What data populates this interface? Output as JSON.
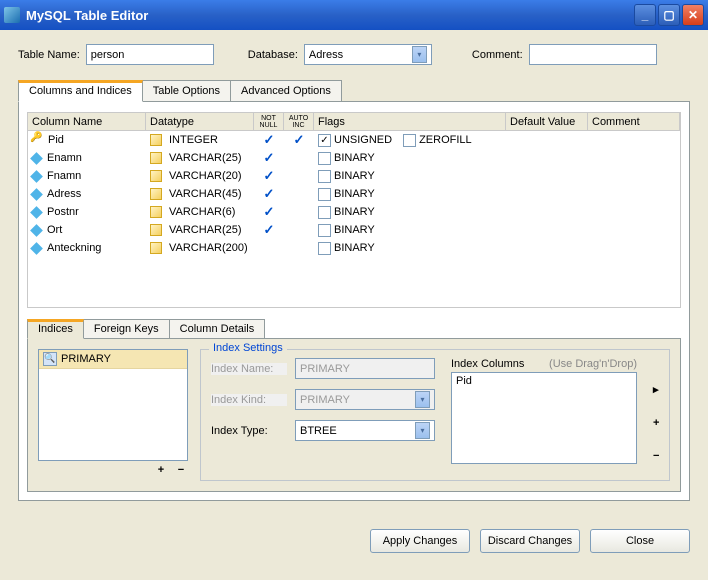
{
  "window": {
    "title": "MySQL Table Editor"
  },
  "top": {
    "table_name_label": "Table Name:",
    "table_name": "person",
    "database_label": "Database:",
    "database": "Adress",
    "comment_label": "Comment:",
    "comment": ""
  },
  "tabs": [
    "Columns and Indices",
    "Table Options",
    "Advanced Options"
  ],
  "col_headers": {
    "name": "Column Name",
    "datatype": "Datatype",
    "notnull": "NOT NULL",
    "autoinc": "AUTO INC",
    "flags": "Flags",
    "default": "Default Value",
    "comment": "Comment"
  },
  "columns": [
    {
      "icon": "key",
      "name": "Pid",
      "datatype": "INTEGER",
      "notnull": true,
      "autoinc": true,
      "flags": [
        {
          "label": "UNSIGNED",
          "checked": true
        },
        {
          "label": "ZEROFILL",
          "checked": false
        }
      ]
    },
    {
      "icon": "diamond",
      "name": "Enamn",
      "datatype": "VARCHAR(25)",
      "notnull": true,
      "autoinc": false,
      "flags": [
        {
          "label": "BINARY",
          "checked": false
        }
      ]
    },
    {
      "icon": "diamond",
      "name": "Fnamn",
      "datatype": "VARCHAR(20)",
      "notnull": true,
      "autoinc": false,
      "flags": [
        {
          "label": "BINARY",
          "checked": false
        }
      ]
    },
    {
      "icon": "diamond",
      "name": "Adress",
      "datatype": "VARCHAR(45)",
      "notnull": true,
      "autoinc": false,
      "flags": [
        {
          "label": "BINARY",
          "checked": false
        }
      ]
    },
    {
      "icon": "diamond",
      "name": "Postnr",
      "datatype": "VARCHAR(6)",
      "notnull": true,
      "autoinc": false,
      "flags": [
        {
          "label": "BINARY",
          "checked": false
        }
      ]
    },
    {
      "icon": "diamond",
      "name": "Ort",
      "datatype": "VARCHAR(25)",
      "notnull": true,
      "autoinc": false,
      "flags": [
        {
          "label": "BINARY",
          "checked": false
        }
      ]
    },
    {
      "icon": "diamond",
      "name": "Anteckning",
      "datatype": "VARCHAR(200)",
      "notnull": false,
      "autoinc": false,
      "flags": [
        {
          "label": "BINARY",
          "checked": false
        }
      ]
    }
  ],
  "sub_tabs": [
    "Indices",
    "Foreign Keys",
    "Column Details"
  ],
  "index_list": [
    "PRIMARY"
  ],
  "index_settings": {
    "legend": "Index Settings",
    "name_label": "Index Name:",
    "name": "PRIMARY",
    "kind_label": "Index Kind:",
    "kind": "PRIMARY",
    "type_label": "Index Type:",
    "type": "BTREE",
    "cols_label": "Index Columns",
    "cols_hint": "(Use Drag'n'Drop)",
    "cols": [
      "Pid"
    ]
  },
  "buttons": {
    "apply": "Apply Changes",
    "discard": "Discard Changes",
    "close": "Close"
  }
}
